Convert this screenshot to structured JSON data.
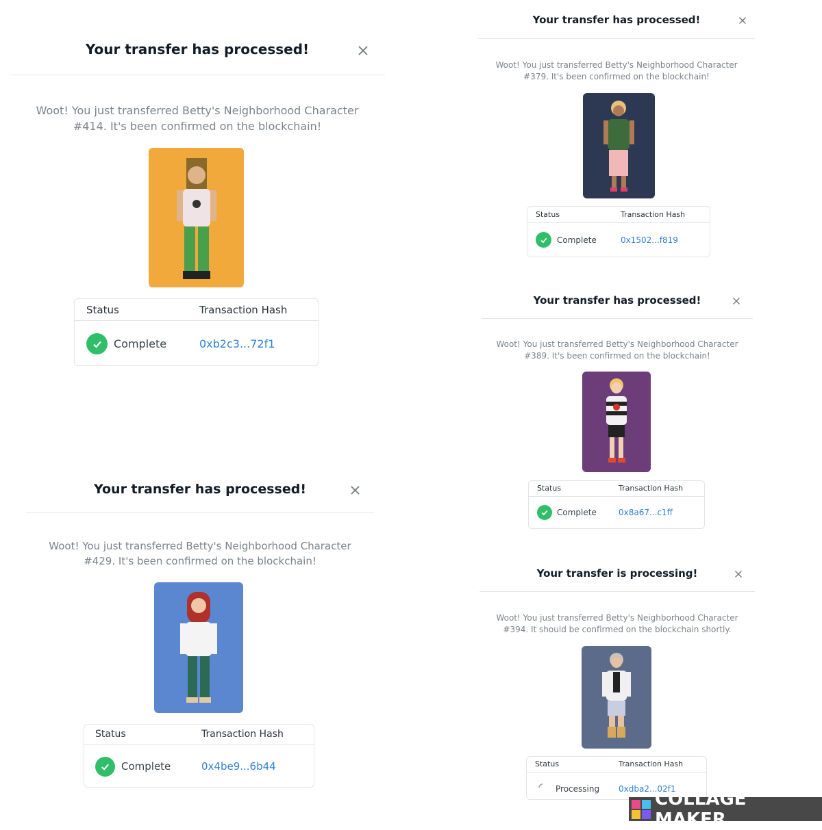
{
  "modals": [
    {
      "title": "Your transfer has processed!",
      "message_line1": "Woot! You just transferred Betty's Neighborhood Character",
      "message_line2": "#414. It's been confirmed on the blockchain!",
      "status_header": "Status",
      "hash_header": "Transaction Hash",
      "status": "Complete",
      "hash": "0xb2c3...72f1",
      "art_bg": "#f2a93b"
    },
    {
      "title": "Your transfer has processed!",
      "message_line1": "Woot! You just transferred Betty's Neighborhood Character",
      "message_line2": "#379. It's been confirmed on the blockchain!",
      "status_header": "Status",
      "hash_header": "Transaction Hash",
      "status": "Complete",
      "hash": "0x1502...f819",
      "art_bg": "#2d3853"
    },
    {
      "title": "Your transfer has processed!",
      "message_line1": "Woot! You just transferred Betty's Neighborhood Character",
      "message_line2": "#389. It's been confirmed on the blockchain!",
      "status_header": "Status",
      "hash_header": "Transaction Hash",
      "status": "Complete",
      "hash": "0x8a67...c1ff",
      "art_bg": "#6c3d78"
    },
    {
      "title": "Your transfer has processed!",
      "message_line1": "Woot! You just transferred Betty's Neighborhood Character",
      "message_line2": "#429. It's been confirmed on the blockchain!",
      "status_header": "Status",
      "hash_header": "Transaction Hash",
      "status": "Complete",
      "hash": "0x4be9...6b44",
      "art_bg": "#5b86d0"
    },
    {
      "title": "Your transfer is processing!",
      "message_line1": "Woot! You just transferred Betty's Neighborhood Character",
      "message_line2": "#394. It should be confirmed on the blockchain shortly.",
      "status_header": "Status",
      "hash_header": "Transaction Hash",
      "status": "Processing",
      "hash": "0xdba2...02f1",
      "art_bg": "#5d6b8a"
    }
  ],
  "watermark": "COLLAGE MAKER",
  "colors": {
    "success": "#2fbf6a",
    "link": "#2f7fd6",
    "close_icon": "close-icon",
    "check_icon": "check-icon",
    "spinner_icon": "spinner-icon"
  }
}
